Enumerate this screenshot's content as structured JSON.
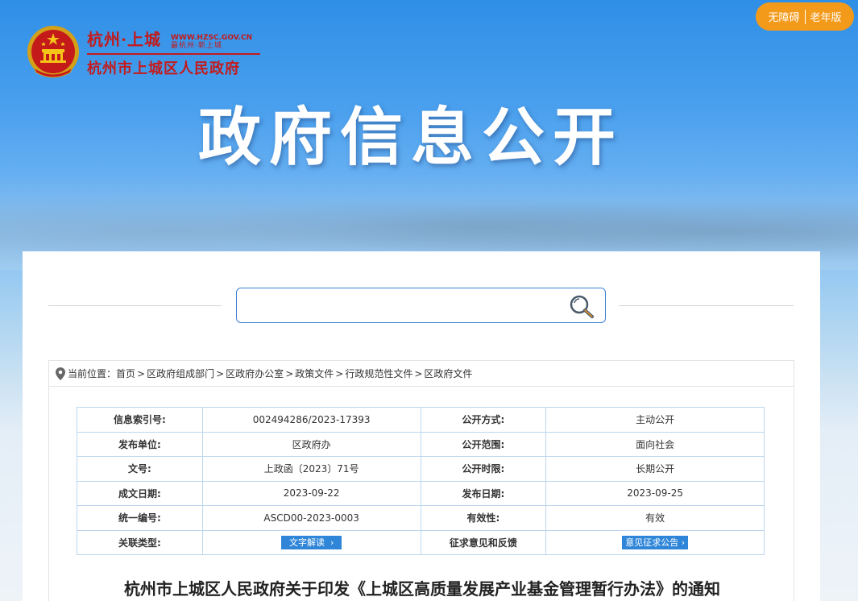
{
  "header": {
    "city_name": "杭州·上城",
    "url": "WWW.HZSC.GOV.CN",
    "slogan": "最杭州·新上城",
    "gov_name": "杭州市上城区人民政府",
    "accessibility": "无障碍",
    "elderly_mode": "老年版",
    "hero_title": "政府信息公开",
    "brand_red": "#c41a1a",
    "accent_orange": "#f39a1a"
  },
  "search": {
    "placeholder": "",
    "icon": "search-icon"
  },
  "breadcrumb": {
    "label": "当前位置：",
    "items": [
      "首页",
      "区政府组成部门",
      "区政府办公室",
      "政策文件",
      "行政规范性文件",
      "区政府文件"
    ],
    "separator": ">"
  },
  "meta": {
    "rows": [
      {
        "l1": "信息索引号:",
        "v1": "002494286/2023-17393",
        "l2": "公开方式:",
        "v2": "主动公开"
      },
      {
        "l1": "发布单位:",
        "v1": "区政府办",
        "l2": "公开范围:",
        "v2": "面向社会"
      },
      {
        "l1": "文号:",
        "v1": "上政函〔2023〕71号",
        "l2": "公开时限:",
        "v2": "长期公开"
      },
      {
        "l1": "成文日期:",
        "v1": "2023-09-22",
        "l2": "发布日期:",
        "v2": "2023-09-25"
      },
      {
        "l1": "统一编号:",
        "v1": "ASCD00-2023-0003",
        "l2": "有效性:",
        "v2": "有效"
      },
      {
        "l1": "关联类型:",
        "v1_btn": "文字解读",
        "l2": "征求意见和反馈",
        "v2_btn": "意见征求公告"
      }
    ],
    "btn_color": "#2f86d8"
  },
  "document": {
    "title": "杭州市上城区人民政府关于印发《上城区高质量发展产业基金管理暂行办法》的通知"
  }
}
